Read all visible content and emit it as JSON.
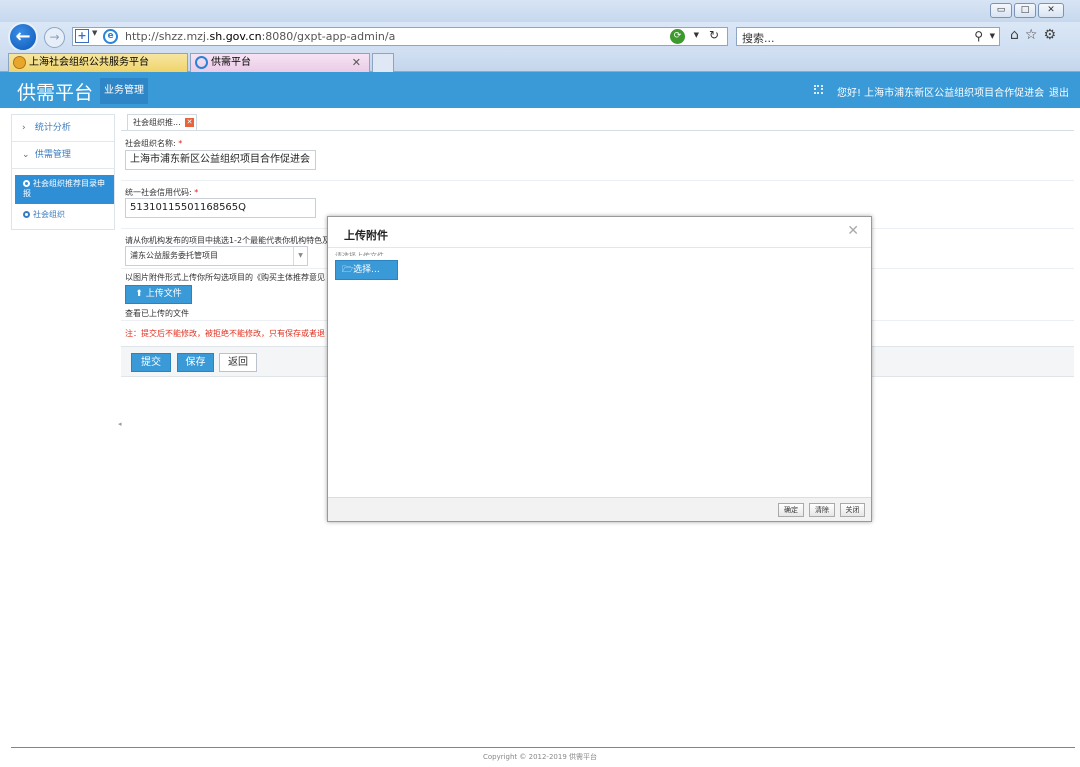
{
  "browser": {
    "url_prefix": "http://shzz.mzj.",
    "url_domain": "sh.gov.cn",
    "url_suffix": ":8080/gxpt-app-admin/a",
    "search_placeholder": "搜索...",
    "tabs": [
      {
        "label": "上海社会组织公共服务平台"
      },
      {
        "label": "供需平台"
      }
    ]
  },
  "header": {
    "logo": "供需平台",
    "nav_item": "业务管理",
    "greeting": "您好! 上海市浦东新区公益组织项目合作促进会",
    "logout": "退出"
  },
  "sidebar": {
    "items": [
      {
        "label": "统计分析"
      },
      {
        "label": "供需管理"
      }
    ],
    "subitems": [
      {
        "label": "社会组织推荐目录申报"
      },
      {
        "label": "社会组织"
      }
    ]
  },
  "page": {
    "tab_label": "社会组织推...",
    "org_name_label": "社会组织名称:",
    "org_name_value": "上海市浦东新区公益组织项目合作促进会",
    "credit_code_label": "统一社会信用代码:",
    "credit_code_value": "51310115501168565Q",
    "project_prompt": "请从你机构发布的项目中挑选1-2个最能代表你机构特色及",
    "project_selected": "浦东公益服务委托管项目",
    "upload_prompt": "以图片附件形式上传你所勾选项目的《购买主体推荐意见",
    "upload_button": "上传文件",
    "view_uploaded": "查看已上传的文件",
    "note": "注：提交后不能修改，被拒绝不能修改，只有保存或者退",
    "buttons": {
      "submit": "提交",
      "save": "保存",
      "back": "返回"
    }
  },
  "modal": {
    "title": "上传附件",
    "hint": "请选择上传文件",
    "select_button": "选择...",
    "footer_buttons": {
      "confirm": "确定",
      "clear": "清除",
      "close": "关闭"
    }
  },
  "footer": {
    "copyright": "Copyright © 2012-2019 供需平台"
  }
}
